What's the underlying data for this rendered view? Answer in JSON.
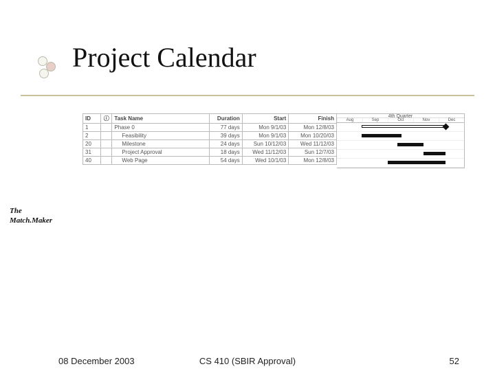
{
  "title": "Project Calendar",
  "side": {
    "line1": "The",
    "line2": "Match.Maker"
  },
  "footer": {
    "date": "08 December 2003",
    "center": "CS 410 (SBIR Approval)",
    "page": "52"
  },
  "grid": {
    "headers": {
      "id": "ID",
      "name": "Task Name",
      "duration": "Duration",
      "start": "Start",
      "finish": "Finish"
    },
    "rows": [
      {
        "id": "1",
        "info": "",
        "name": "Phase 0",
        "indent": false,
        "dur": "77 days",
        "start": "Mon 9/1/03",
        "finish": "Mon 12/8/03"
      },
      {
        "id": "2",
        "info": "",
        "name": "Feasibility",
        "indent": true,
        "dur": "39 days",
        "start": "Mon 9/1/03",
        "finish": "Mon 10/20/03"
      },
      {
        "id": "20",
        "info": "",
        "name": "Milestone",
        "indent": true,
        "dur": "24 days",
        "start": "Sun 10/12/03",
        "finish": "Wed 11/12/03"
      },
      {
        "id": "31",
        "info": "",
        "name": "Project Approval",
        "indent": true,
        "dur": "18 days",
        "start": "Wed 11/12/03",
        "finish": "Sun 12/7/03"
      },
      {
        "id": "40",
        "info": "",
        "name": "Web Page",
        "indent": true,
        "dur": "54 days",
        "start": "Wed 10/1/03",
        "finish": "Mon 12/8/03"
      }
    ]
  },
  "chart_data": {
    "type": "gantt",
    "title": "Project Calendar",
    "quarter_label": "4th Quarter",
    "months": [
      "Aug",
      "Sep",
      "Oct",
      "Nov",
      "Dec"
    ],
    "x_range": [
      "2003-08-01",
      "2003-12-31"
    ],
    "tasks": [
      {
        "name": "Phase 0",
        "start": "2003-09-01",
        "finish": "2003-12-08",
        "style": "summary"
      },
      {
        "name": "Feasibility",
        "start": "2003-09-01",
        "finish": "2003-10-20",
        "style": "bar"
      },
      {
        "name": "Milestone",
        "start": "2003-10-12",
        "finish": "2003-11-12",
        "style": "bar"
      },
      {
        "name": "Project Approval",
        "start": "2003-11-12",
        "finish": "2003-12-07",
        "style": "bar"
      },
      {
        "name": "Web Page",
        "start": "2003-10-01",
        "finish": "2003-12-08",
        "style": "bar"
      }
    ]
  }
}
